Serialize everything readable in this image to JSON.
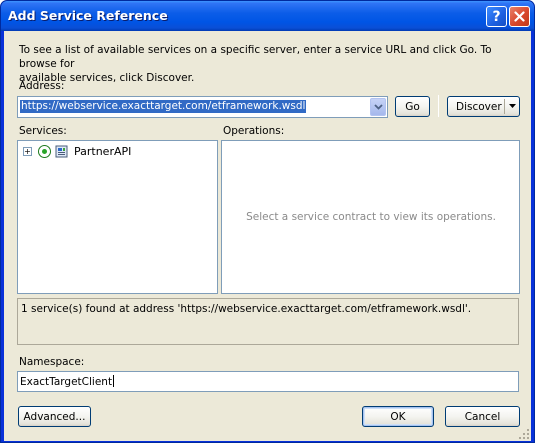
{
  "window": {
    "title": "Add Service Reference",
    "help_label": "?",
    "close_label": "✕"
  },
  "intro": {
    "line1": "To see a list of available services on a specific server, enter a service URL and click Go. To browse for",
    "line2": "available services, click Discover."
  },
  "address": {
    "label": "Address:",
    "value": "https://webservice.exacttarget.com/etframework.wsdl"
  },
  "buttons": {
    "go": "Go",
    "discover": "Discover",
    "advanced": "Advanced...",
    "ok": "OK",
    "cancel": "Cancel"
  },
  "services": {
    "label": "Services:",
    "items": [
      {
        "label": "PartnerAPI",
        "icon": "service-icon"
      }
    ]
  },
  "operations": {
    "label": "Operations:",
    "placeholder": "Select a service contract to view its operations."
  },
  "status": {
    "message": "1 service(s) found at address 'https://webservice.exacttarget.com/etframework.wsdl'."
  },
  "namespace": {
    "label": "Namespace:",
    "value": "ExactTargetClient"
  },
  "colors": {
    "titlebar": "#0055e5",
    "client_bg": "#ece9d8",
    "selection": "#316ac5",
    "border": "#7f9db9"
  }
}
